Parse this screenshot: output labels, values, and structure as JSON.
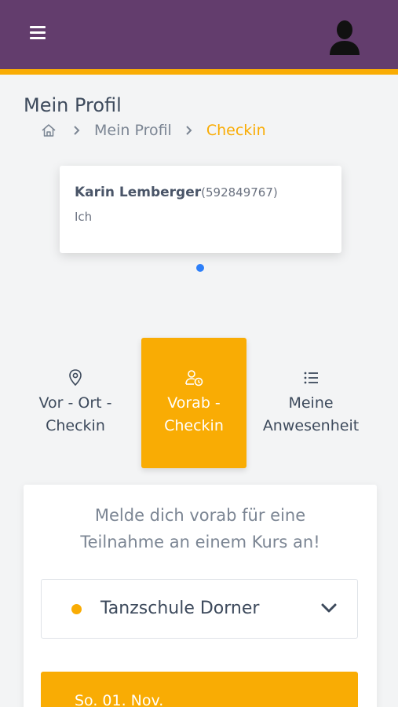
{
  "header": {
    "menu_icon": "hamburger-menu-icon",
    "avatar_icon": "user-silhouette-icon",
    "bar_color": "#633d6d",
    "accent_color": "#f9ac04"
  },
  "page": {
    "title": "Mein Profil"
  },
  "breadcrumb": {
    "home_icon": "home-icon",
    "items": [
      "Mein Profil",
      "Checkin"
    ]
  },
  "member_card": {
    "name": "Karin Lemberger",
    "id": "(592849767)",
    "relation": "Ich"
  },
  "carousel": {
    "page_count": 1,
    "active_index": 0
  },
  "tabs": [
    {
      "label_line1": "Vor - Ort -",
      "label_line2": "Checkin",
      "icon": "location-pin-icon",
      "active": false
    },
    {
      "label_line1": "Vorab -",
      "label_line2": "Checkin",
      "icon": "user-clock-icon",
      "active": true
    },
    {
      "label_line1": "Meine",
      "label_line2": "Anwesenheit",
      "icon": "list-icon",
      "active": false
    }
  ],
  "checkin_panel": {
    "prompt_line1": "Melde dich vorab für eine",
    "prompt_line2": "Teilnahme an einem Kurs an!",
    "school_select": {
      "value": "Tanzschule Dorner",
      "icon": "chevron-down-icon"
    },
    "date_label": "So. 01. Nov."
  }
}
